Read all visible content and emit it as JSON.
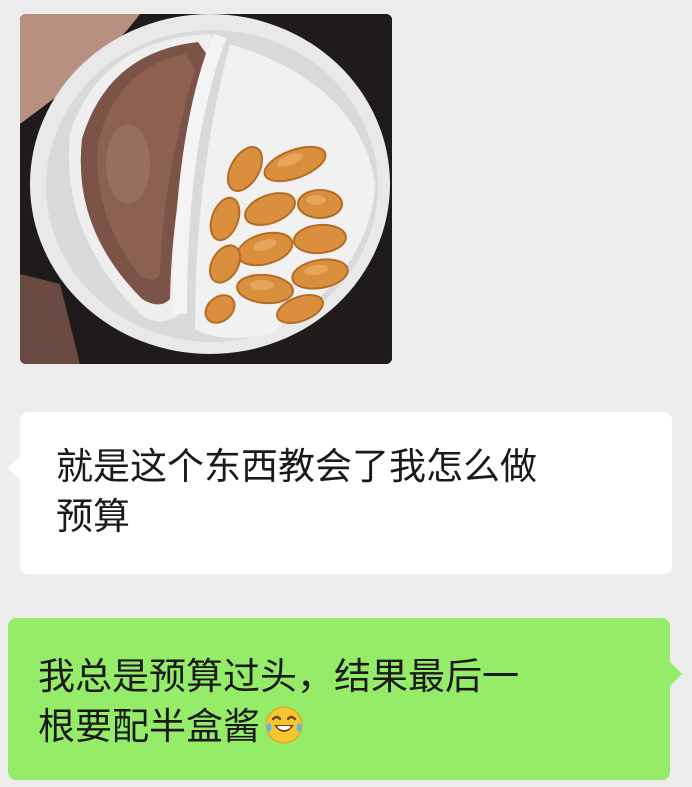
{
  "messages": [
    {
      "type": "image",
      "direction": "received",
      "content": "chocolate-dip-biscuit-snack-cup-photo"
    },
    {
      "type": "text",
      "direction": "received",
      "text": "就是这个东西教会了我怎么做\n预算",
      "bubble_color": "#ffffff"
    },
    {
      "type": "text",
      "direction": "sent",
      "text": "我总是预算过头，结果最后一\n根要配半盒酱",
      "emoji": "laughing-tears-emoji",
      "bubble_color": "#95ec69"
    }
  ],
  "colors": {
    "background": "#ededed",
    "received_bubble": "#ffffff",
    "sent_bubble": "#95ec69",
    "text": "#1a1a1a"
  }
}
